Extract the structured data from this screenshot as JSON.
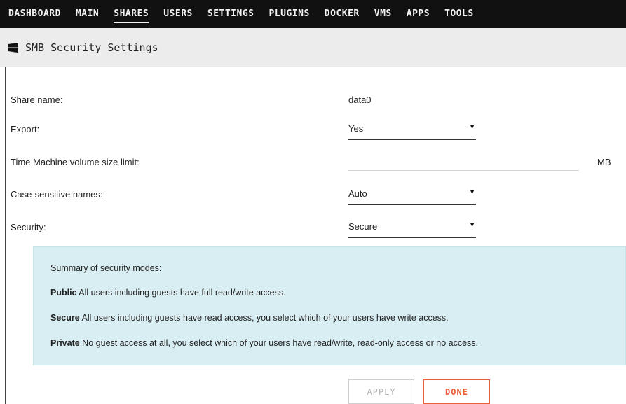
{
  "nav": {
    "items": [
      "DASHBOARD",
      "MAIN",
      "SHARES",
      "USERS",
      "SETTINGS",
      "PLUGINS",
      "DOCKER",
      "VMS",
      "APPS",
      "TOOLS"
    ],
    "active": "SHARES"
  },
  "header": {
    "icon": "windows-icon",
    "title": "SMB Security Settings"
  },
  "form": {
    "share_name_label": "Share name:",
    "share_name_value": "data0",
    "export_label": "Export:",
    "export_value": "Yes",
    "tm_label": "Time Machine volume size limit:",
    "tm_value": "",
    "tm_unit": "MB",
    "case_label": "Case-sensitive names:",
    "case_value": "Auto",
    "security_label": "Security:",
    "security_value": "Secure"
  },
  "summary": {
    "heading": "Summary of security modes:",
    "public_mode": "Public",
    "public_desc": " All users including guests have full read/write access.",
    "secure_mode": "Secure",
    "secure_desc": " All users including guests have read access, you select which of your users have write access.",
    "private_mode": "Private",
    "private_desc": " No guest access at all, you select which of your users have read/write, read-only access or no access."
  },
  "buttons": {
    "apply": "APPLY",
    "done": "DONE"
  },
  "colors": {
    "nav_bg": "#111111",
    "accent": "#e8613a",
    "info_bg": "#d9eef3"
  }
}
